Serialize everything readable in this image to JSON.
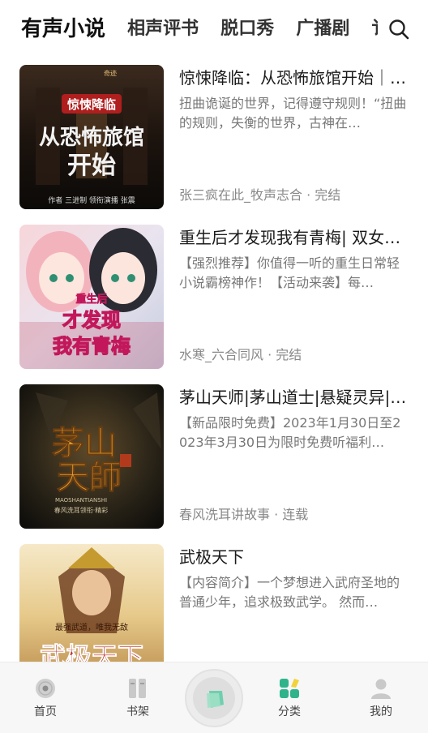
{
  "header": {
    "tabs": [
      {
        "label": "有声小说",
        "active": true
      },
      {
        "label": "相声评书",
        "active": false
      },
      {
        "label": "脱口秀",
        "active": false
      },
      {
        "label": "广播剧",
        "active": false
      },
      {
        "label": "讠",
        "active": false
      }
    ],
    "search_icon": "search-icon"
  },
  "books": [
    {
      "title": "惊悚降临：从恐怖旅馆开始｜多人…",
      "desc": "扭曲诡诞的世界，记得遵守规则！“扭曲的规则，失衡的世界，古神在…",
      "meta": "张三疯在此_牧声志合 · 完结",
      "cover_text": "惊悚降临",
      "cover_big": "从恐怖旅馆开始",
      "cover_footer": "作者 三进制   领衔演播 张震",
      "cover_badge": "奇迹"
    },
    {
      "title": "重生后才发现我有青梅| 双女主…",
      "desc": "【强烈推荐】你值得一听的重生日常轻小说霸榜神作！【活动来袭】每…",
      "meta": "水寒_六合同风 · 完结",
      "cover_text": "重生后",
      "cover_big": "才发现我有青梅",
      "cover_footer": ""
    },
    {
      "title": "茅山天师|茅山道士|悬疑灵异|…",
      "desc": "【新品限时免费】2023年1月30日至2023年3月30日为限时免费听福利…",
      "meta": "春风洗耳讲故事 · 连载",
      "cover_text": "MAOSHANTIANSHI",
      "cover_big": "茅山天師",
      "cover_footer": "春风洗耳领衔·精彩"
    },
    {
      "title": "武极天下",
      "desc": "【内容简介】一个梦想进入武府圣地的普通少年，追求极致武学。 然而…",
      "meta": "",
      "cover_text": "最强武道，唯我无敌",
      "cover_big": "武极天下",
      "cover_footer": ""
    }
  ],
  "nav": {
    "items": [
      {
        "label": "首页",
        "icon": "disc-icon",
        "active": false
      },
      {
        "label": "书架",
        "icon": "bookshelf-icon",
        "active": false
      },
      {
        "label": "",
        "icon": "play-center-icon",
        "active": false
      },
      {
        "label": "分类",
        "icon": "category-icon",
        "active": true
      },
      {
        "label": "我的",
        "icon": "profile-icon",
        "active": false
      }
    ]
  },
  "colors": {
    "accent": "#2fb38b",
    "text_primary": "#1a1a1a",
    "text_secondary": "#777777",
    "nav_bg": "#f7f7f7"
  }
}
